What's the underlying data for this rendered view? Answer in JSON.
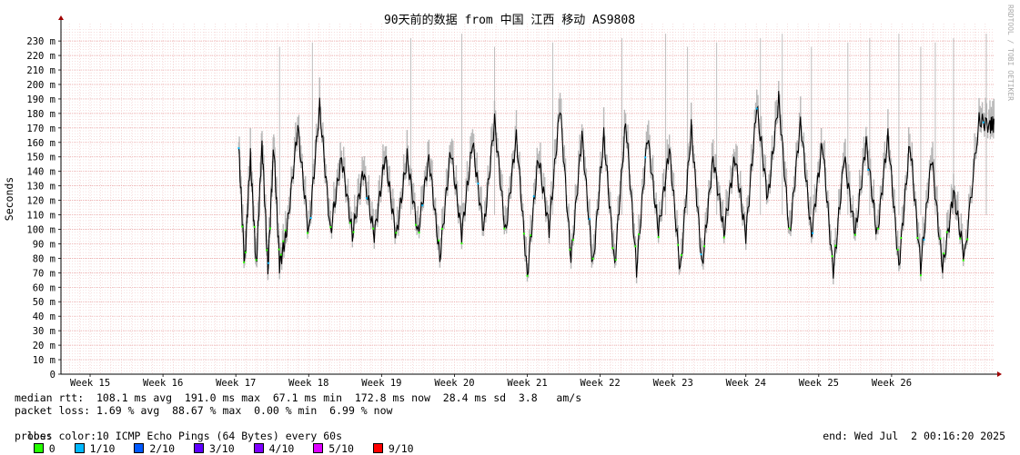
{
  "chart_data": {
    "type": "line",
    "title": "90天前的数据 from 中国 江西 移动 AS9808",
    "ylabel": "Seconds",
    "ylim": [
      0,
      240
    ],
    "yticks": [
      0,
      10,
      20,
      30,
      40,
      50,
      60,
      70,
      80,
      90,
      100,
      110,
      120,
      130,
      140,
      150,
      160,
      170,
      180,
      190,
      200,
      210,
      220,
      230
    ],
    "ytick_labels": [
      "0",
      "10 m",
      "20 m",
      "30 m",
      "40 m",
      "50 m",
      "60 m",
      "70 m",
      "80 m",
      "90 m",
      "100 m",
      "110 m",
      "120 m",
      "130 m",
      "140 m",
      "150 m",
      "160 m",
      "170 m",
      "180 m",
      "190 m",
      "200 m",
      "210 m",
      "220 m",
      "230 m"
    ],
    "xlim": [
      14.6,
      27.4
    ],
    "xtick_labels": [
      {
        "week": 15,
        "label": "Week 15"
      },
      {
        "week": 16,
        "label": "Week 16"
      },
      {
        "week": 17,
        "label": "Week 17"
      },
      {
        "week": 18,
        "label": "Week 18"
      },
      {
        "week": 19,
        "label": "Week 19"
      },
      {
        "week": 20,
        "label": "Week 20"
      },
      {
        "week": 21,
        "label": "Week 21"
      },
      {
        "week": 22,
        "label": "Week 22"
      },
      {
        "week": 23,
        "label": "Week 23"
      },
      {
        "week": 24,
        "label": "Week 24"
      },
      {
        "week": 25,
        "label": "Week 25"
      },
      {
        "week": 26,
        "label": "Week 26"
      }
    ],
    "grid": true,
    "watermark": "RRDTOOL / TOBI OETIKER",
    "series": [
      {
        "name": "median rtt",
        "color": "#000000",
        "x": [
          17.04,
          17.12,
          17.2,
          17.28,
          17.36,
          17.44,
          17.52,
          17.6,
          17.7,
          17.85,
          18.0,
          18.15,
          18.3,
          18.45,
          18.6,
          18.75,
          18.9,
          19.05,
          19.2,
          19.35,
          19.5,
          19.65,
          19.8,
          19.95,
          20.1,
          20.25,
          20.4,
          20.55,
          20.7,
          20.85,
          21.0,
          21.15,
          21.3,
          21.45,
          21.6,
          21.75,
          21.9,
          22.05,
          22.2,
          22.35,
          22.5,
          22.65,
          22.8,
          22.95,
          23.1,
          23.25,
          23.4,
          23.55,
          23.7,
          23.85,
          24.0,
          24.15,
          24.3,
          24.45,
          24.6,
          24.75,
          24.9,
          25.05,
          25.2,
          25.35,
          25.5,
          25.65,
          25.8,
          25.95,
          26.1,
          26.25,
          26.4,
          26.55,
          26.7,
          26.85,
          27.0,
          27.2,
          27.35
        ],
        "y": [
          156,
          75,
          150,
          74,
          160,
          72,
          158,
          75,
          98,
          170,
          96,
          185,
          98,
          150,
          96,
          140,
          95,
          150,
          94,
          150,
          97,
          150,
          80,
          155,
          96,
          160,
          98,
          175,
          97,
          165,
          68,
          150,
          100,
          185,
          78,
          165,
          74,
          165,
          75,
          175,
          72,
          165,
          98,
          155,
          70,
          170,
          74,
          150,
          98,
          150,
          95,
          185,
          120,
          190,
          95,
          175,
          96,
          160,
          68,
          150,
          96,
          160,
          95,
          165,
          74,
          160,
          74,
          150,
          72,
          125,
          80,
          175,
          172
        ]
      }
    ]
  },
  "stats": {
    "median_rtt": "median rtt:  108.1 ms avg  191.0 ms max  67.1 ms min  172.8 ms now  28.4 ms sd  3.8   am/s",
    "packet_loss": "packet loss: 1.69 % avg  88.67 % max  0.00 % min  6.99 % now",
    "loss_color_label": "loss color:",
    "loss_colors": [
      {
        "label": "0",
        "color": "#26ff00"
      },
      {
        "label": "1/10",
        "color": "#00b8ff"
      },
      {
        "label": "2/10",
        "color": "#0059ff"
      },
      {
        "label": "3/10",
        "color": "#5e00ff"
      },
      {
        "label": "4/10",
        "color": "#7e00ff"
      },
      {
        "label": "5/10",
        "color": "#dd00ff"
      },
      {
        "label": "9/10",
        "color": "#ff0000"
      }
    ],
    "probe": "probe:       10 ICMP Echo Pings (64 Bytes) every 60s",
    "end": "end: Wed Jul  2 00:16:20 2025"
  }
}
